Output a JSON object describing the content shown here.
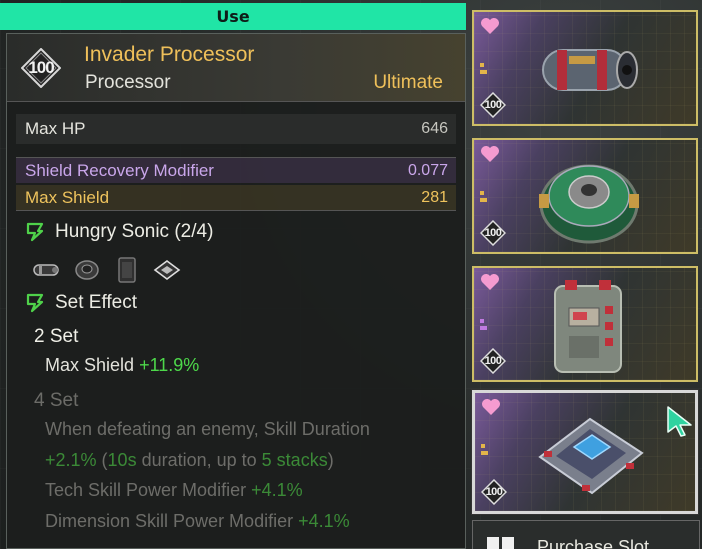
{
  "use_button": {
    "label": "Use"
  },
  "tooltip": {
    "level": "100",
    "name": "Invader Processor",
    "type": "Processor",
    "rarity": "Ultimate",
    "base_stat": {
      "label": "Max HP",
      "value": "646"
    },
    "sub_stats": [
      {
        "label": "Shield Recovery Modifier",
        "value": "0.077"
      },
      {
        "label": "Max Shield",
        "value": "281"
      }
    ],
    "set": {
      "title": "Hungry Sonic (2/4)",
      "parts": [
        "core-part-icon",
        "ring-part-icon",
        "chip-part-icon",
        "board-part-icon"
      ],
      "effect_label": "Set Effect",
      "set2": {
        "head": "2 Set",
        "stat": "Max Shield",
        "bonus": "+11.9%"
      },
      "set4": {
        "head": "4 Set",
        "line1": "When defeating an enemy, Skill Duration",
        "line2_bonus": "+2.1%",
        "line2_paren_open": " (",
        "line2_duration": "10s",
        "line2_mid": " duration, up to ",
        "line2_stacks": "5 stacks",
        "line2_paren_close": ")",
        "line3_label": "Tech Skill Power Modifier",
        "line3_bonus": "+4.1%",
        "line4_label": "Dimension Skill Power Modifier",
        "line4_bonus": "+4.1%"
      }
    }
  },
  "slots": [
    {
      "level": "100",
      "icon": "capsule-core-icon"
    },
    {
      "level": "100",
      "icon": "round-processor-icon"
    },
    {
      "level": "100",
      "icon": "block-module-icon"
    },
    {
      "level": "100",
      "icon": "chip-board-icon"
    }
  ],
  "bottom_button": {
    "label": "Purchase Slot"
  },
  "colors": {
    "accent": "#20e5a6",
    "rarity_gold": "#efc05a",
    "sub_stat_purple": "#c9a6ea",
    "bonus_green": "#4dd84a",
    "heart_pink": "#f59bd0"
  }
}
